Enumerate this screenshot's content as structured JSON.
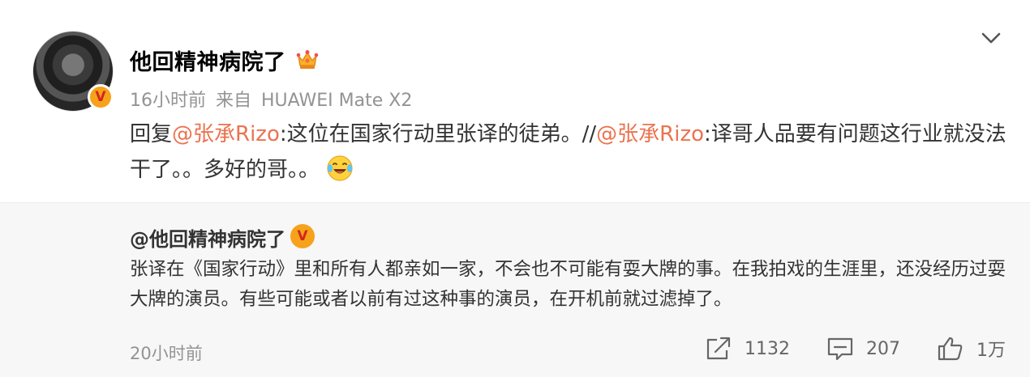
{
  "post": {
    "username": "他回精神病院了",
    "verified_badge": "V",
    "meta_time": "16小时前",
    "meta_source_prefix": "来自",
    "meta_device": "HUAWEI Mate X2",
    "content": {
      "reply_prefix": "回复",
      "mention1": "@张承Rizo",
      "text1": ":这位在国家行动里张译的徒弟。//",
      "mention2": "@张承Rizo",
      "text2": ":译哥人品要有问题这行业就没法干了。。多好的哥。。"
    },
    "icons": {
      "crown": "crown-icon",
      "menu": "chevron-down-icon",
      "emoji": "laughing-tears-emoji-icon"
    }
  },
  "repost": {
    "username": "@他回精神病院了",
    "verified_badge": "V",
    "text": "张译在《国家行动》里和所有人都亲如一家，不会也不可能有耍大牌的事。在我拍戏的生涯里，还没经历过耍大牌的演员。有些可能或者以前有过这种事的演员，在开机前就过滤掉了。",
    "time": "20小时前",
    "actions": {
      "share_count": "1132",
      "comment_count": "207",
      "like_count": "1万"
    }
  },
  "colors": {
    "mention": "#eb7350",
    "badge": "#f7a21b",
    "meta": "#939393",
    "repost_bg": "#f7f7f7"
  }
}
